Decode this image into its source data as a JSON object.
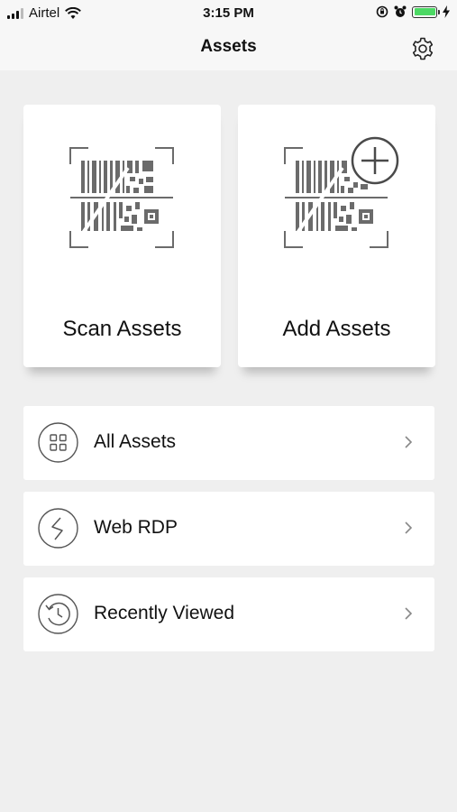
{
  "status_bar": {
    "carrier": "Airtel",
    "time": "3:15 PM"
  },
  "nav": {
    "title": "Assets"
  },
  "tiles": [
    {
      "label": "Scan Assets",
      "icon": "barcode-scan-icon"
    },
    {
      "label": "Add Assets",
      "icon": "barcode-add-icon"
    }
  ],
  "rows": [
    {
      "label": "All Assets",
      "icon": "grid-icon"
    },
    {
      "label": "Web RDP",
      "icon": "remote-desktop-icon"
    },
    {
      "label": "Recently Viewed",
      "icon": "history-clock-icon"
    }
  ],
  "colors": {
    "background": "#efefef",
    "battery": "#4cd964",
    "icon_gray": "#6b6b6b"
  }
}
